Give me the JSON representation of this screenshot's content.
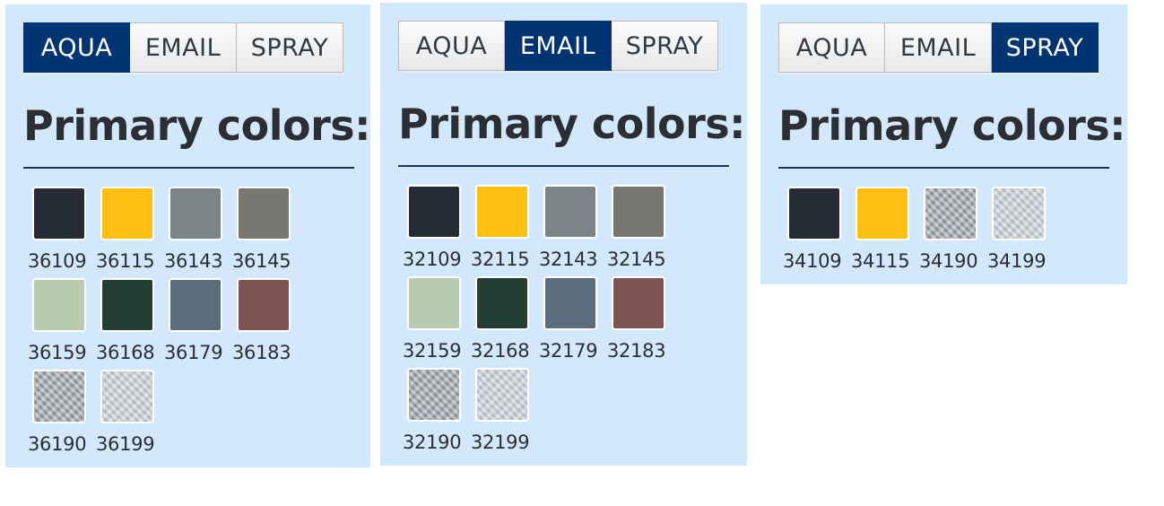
{
  "panels": [
    {
      "tabs": [
        {
          "label": "AQUA",
          "active": true
        },
        {
          "label": "EMAIL",
          "active": false
        },
        {
          "label": "SPRAY",
          "active": false
        }
      ],
      "heading": "Primary colors:",
      "swatches": [
        {
          "code": "36109",
          "color": "#272d36"
        },
        {
          "code": "36115",
          "color": "#fcbf12"
        },
        {
          "code": "36143",
          "color": "#7d8487"
        },
        {
          "code": "36145",
          "color": "#767770"
        },
        {
          "code": "36159",
          "color": "#b9cbae"
        },
        {
          "code": "36168",
          "color": "#243f33"
        },
        {
          "code": "36179",
          "color": "#5b6d7b"
        },
        {
          "code": "36183",
          "color": "#7d5451"
        },
        {
          "code": "36190",
          "color": "#a6abb0",
          "texture": "tex-mid"
        },
        {
          "code": "36199",
          "color": "#c2c9d0",
          "texture": "tex-light"
        }
      ]
    },
    {
      "tabs": [
        {
          "label": "AQUA",
          "active": false
        },
        {
          "label": "EMAIL",
          "active": true
        },
        {
          "label": "SPRAY",
          "active": false
        }
      ],
      "heading": "Primary colors:",
      "swatches": [
        {
          "code": "32109",
          "color": "#272d36"
        },
        {
          "code": "32115",
          "color": "#fcbf12"
        },
        {
          "code": "32143",
          "color": "#7d8487"
        },
        {
          "code": "32145",
          "color": "#767770"
        },
        {
          "code": "32159",
          "color": "#b9cbae"
        },
        {
          "code": "32168",
          "color": "#243f33"
        },
        {
          "code": "32179",
          "color": "#5b6d7b"
        },
        {
          "code": "32183",
          "color": "#7d5451"
        },
        {
          "code": "32190",
          "color": "#a6abb0",
          "texture": "tex-mid"
        },
        {
          "code": "32199",
          "color": "#c2c9d0",
          "texture": "tex-light"
        }
      ]
    },
    {
      "tabs": [
        {
          "label": "AQUA",
          "active": false
        },
        {
          "label": "EMAIL",
          "active": false
        },
        {
          "label": "SPRAY",
          "active": true
        }
      ],
      "heading": "Primary colors:",
      "swatches": [
        {
          "code": "34109",
          "color": "#272d36"
        },
        {
          "code": "34115",
          "color": "#fcbf12"
        },
        {
          "code": "34190",
          "color": "#a6abb0",
          "texture": "tex-mid"
        },
        {
          "code": "34199",
          "color": "#c2c9d0",
          "texture": "tex-light"
        }
      ]
    }
  ]
}
